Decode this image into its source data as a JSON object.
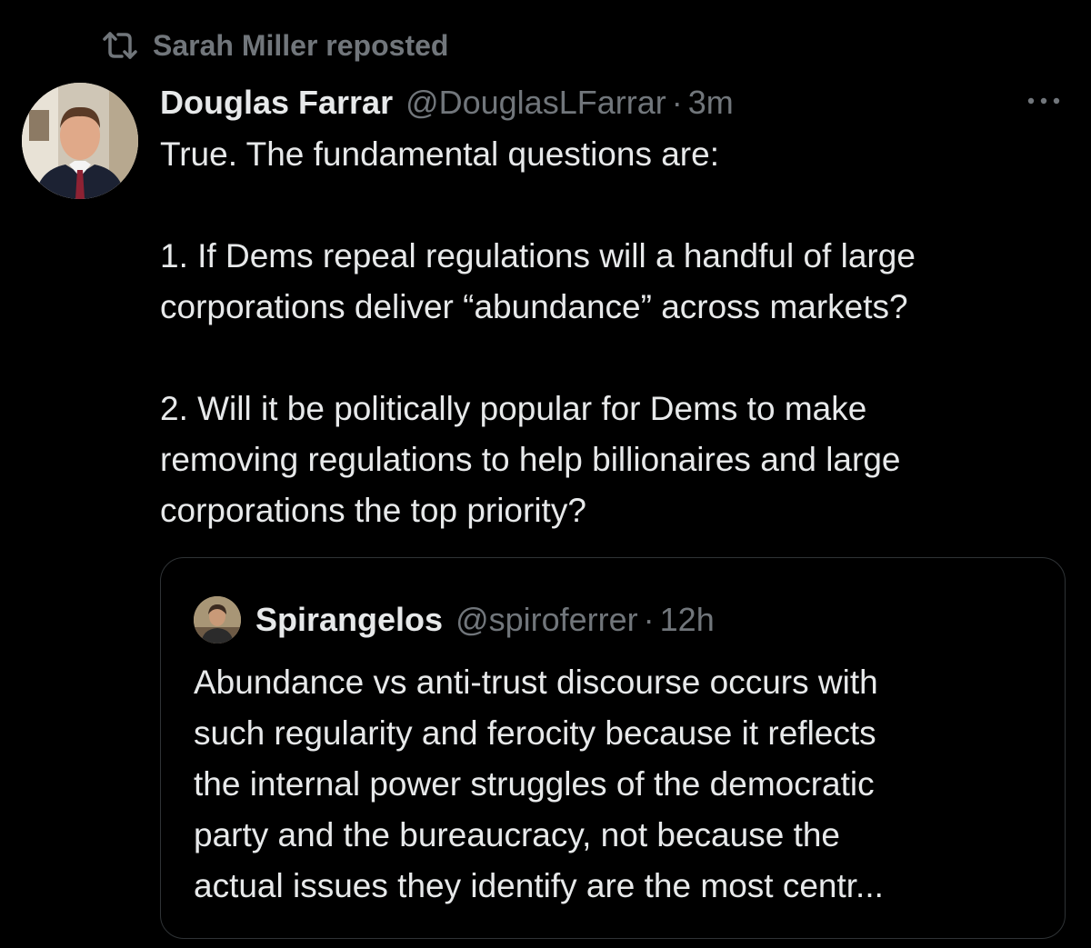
{
  "colors": {
    "background": "#000000",
    "primary_text": "#e7e9ea",
    "secondary_text": "#71767b",
    "card_border": "#2f3336"
  },
  "repost": {
    "icon": "repost-icon",
    "text": "Sarah Miller reposted"
  },
  "post": {
    "avatar_icon": "avatar-photo",
    "author_name": "Douglas Farrar",
    "handle": "@DouglasLFarrar",
    "separator": "·",
    "time": "3m",
    "more_icon": "more-options-icon",
    "text_lines": [
      "True. The fundamental questions are:",
      "1. If Dems repeal regulations will a handful of large",
      "corporations deliver “abundance” across markets?",
      "2. Will it be politically popular for Dems to make",
      "removing regulations to help billionaires and large",
      "corporations the top priority?"
    ]
  },
  "quote": {
    "avatar_icon": "avatar-photo",
    "author_name": "Spirangelos",
    "handle": "@spiroferrer",
    "separator": "·",
    "time": "12h",
    "text_lines": [
      "Abundance vs anti-trust discourse occurs with",
      "such regularity and ferocity because it reflects",
      "the internal power struggles of the democratic",
      "party and the bureaucracy, not because the",
      "actual issues they identify are the most centr..."
    ]
  }
}
